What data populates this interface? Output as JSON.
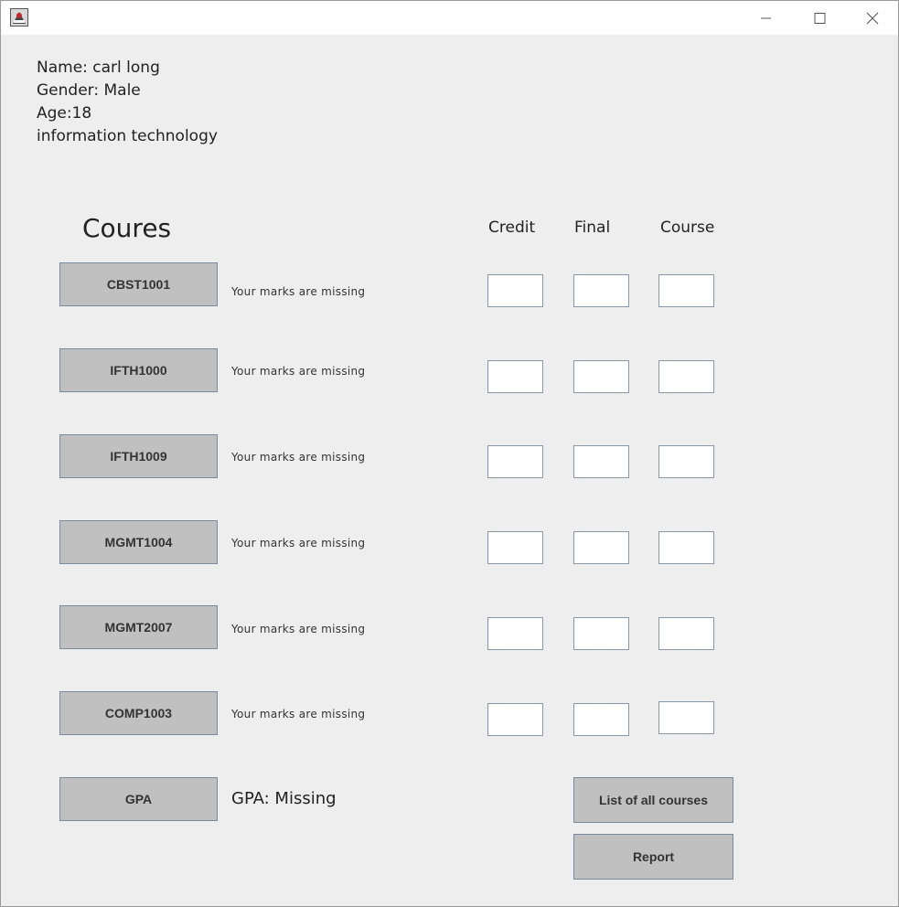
{
  "window": {
    "icon": "java-app-icon",
    "controls": {
      "minimize": "minimize-icon",
      "maximize": "maximize-icon",
      "close": "close-icon"
    }
  },
  "student": {
    "name": "Name: carl long",
    "gender": "Gender: Male",
    "age": "Age:18",
    "program": "information technology"
  },
  "courses_title": "Coures",
  "columns": {
    "credit": "Credit",
    "final": "Final",
    "course": "Course"
  },
  "courses": [
    {
      "code": "CBST1001",
      "status": "Your marks are missing",
      "credit": "",
      "final": "",
      "course": ""
    },
    {
      "code": "IFTH1000",
      "status": "Your marks are missing",
      "credit": "",
      "final": "",
      "course": ""
    },
    {
      "code": "IFTH1009",
      "status": "Your marks are missing",
      "credit": "",
      "final": "",
      "course": ""
    },
    {
      "code": "MGMT1004",
      "status": "Your marks are missing",
      "credit": "",
      "final": "",
      "course": ""
    },
    {
      "code": "MGMT2007",
      "status": "Your marks are missing",
      "credit": "",
      "final": "",
      "course": ""
    },
    {
      "code": "COMP1003",
      "status": "Your marks are missing",
      "credit": "",
      "final": "",
      "course": ""
    }
  ],
  "gpa": {
    "button_label": "GPA",
    "text": "GPA: Missing"
  },
  "buttons": {
    "list_courses": "List of all courses",
    "report": "Report"
  },
  "colors": {
    "window_bg": "#eeeeee",
    "button_bg": "#c0c0c1",
    "button_border": "#7a8a9e"
  }
}
